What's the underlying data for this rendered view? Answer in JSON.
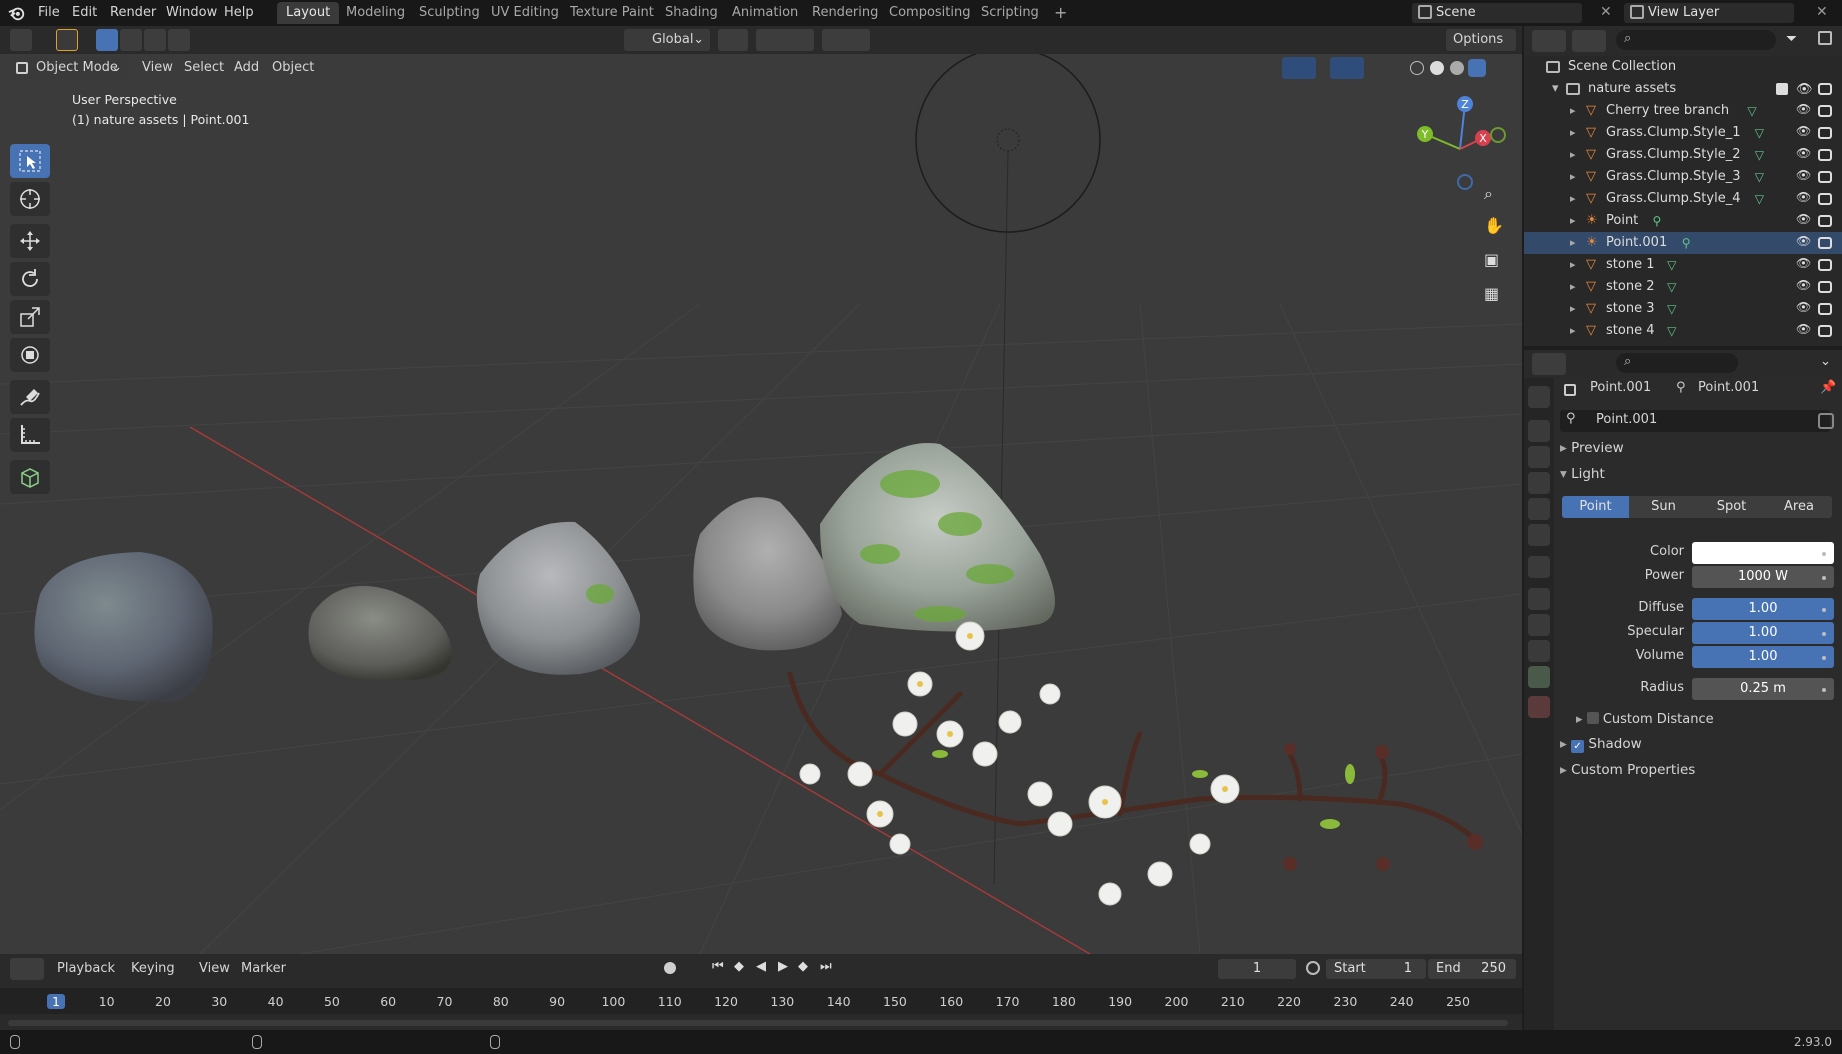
{
  "top_menu": [
    "File",
    "Edit",
    "Render",
    "Window",
    "Help"
  ],
  "workspaces": [
    "Layout",
    "Modeling",
    "Sculpting",
    "UV Editing",
    "Texture Paint",
    "Shading",
    "Animation",
    "Rendering",
    "Compositing",
    "Scripting"
  ],
  "active_workspace": "Layout",
  "scene_name": "Scene",
  "view_layer": "View Layer",
  "viewport": {
    "transform_orientation": "Global",
    "mode": "Object Mode",
    "menus": [
      "View",
      "Select",
      "Add",
      "Object"
    ],
    "options_label": "Options",
    "overlay_title": "User Perspective",
    "overlay_subtitle": "(1) nature assets | Point.001",
    "gizmo_axes": {
      "x": "X",
      "y": "Y",
      "z": "Z"
    }
  },
  "timeline": {
    "menus": [
      "Playback",
      "Keying",
      "View",
      "Marker"
    ],
    "current_frame": "1",
    "start_label": "Start",
    "start_value": "1",
    "end_label": "End",
    "end_value": "250",
    "ticks": [
      "1",
      "10",
      "20",
      "30",
      "40",
      "50",
      "60",
      "70",
      "80",
      "90",
      "100",
      "110",
      "120",
      "130",
      "140",
      "150",
      "160",
      "170",
      "180",
      "190",
      "200",
      "210",
      "220",
      "230",
      "240",
      "250"
    ]
  },
  "outliner": {
    "root": "Scene Collection",
    "collection": "nature assets",
    "items": [
      {
        "name": "Cherry tree branch",
        "type": "mesh"
      },
      {
        "name": "Grass.Clump.Style_1",
        "type": "mesh"
      },
      {
        "name": "Grass.Clump.Style_2",
        "type": "mesh"
      },
      {
        "name": "Grass.Clump.Style_3",
        "type": "mesh"
      },
      {
        "name": "Grass.Clump.Style_4",
        "type": "mesh"
      },
      {
        "name": "Point",
        "type": "light"
      },
      {
        "name": "Point.001",
        "type": "light"
      },
      {
        "name": "stone 1",
        "type": "mesh"
      },
      {
        "name": "stone 2",
        "type": "mesh"
      },
      {
        "name": "stone 3",
        "type": "mesh"
      },
      {
        "name": "stone 4",
        "type": "mesh"
      }
    ]
  },
  "properties": {
    "object_name": "Point.001",
    "data_name": "Point.001",
    "datablock_name": "Point.001",
    "panels": {
      "preview": "Preview",
      "light": "Light",
      "custom_distance": "Custom Distance",
      "shadow": "Shadow",
      "custom_properties": "Custom Properties"
    },
    "light_types": [
      "Point",
      "Sun",
      "Spot",
      "Area"
    ],
    "active_light_type": "Point",
    "fields": {
      "color_label": "Color",
      "power_label": "Power",
      "power_value": "1000 W",
      "diffuse_label": "Diffuse",
      "diffuse_value": "1.00",
      "specular_label": "Specular",
      "specular_value": "1.00",
      "volume_label": "Volume",
      "volume_value": "1.00",
      "radius_label": "Radius",
      "radius_value": "0.25 m"
    },
    "color_value": "#ffffff",
    "shadow_checked": true,
    "custom_distance_checked": false
  },
  "version": "2.93.0"
}
